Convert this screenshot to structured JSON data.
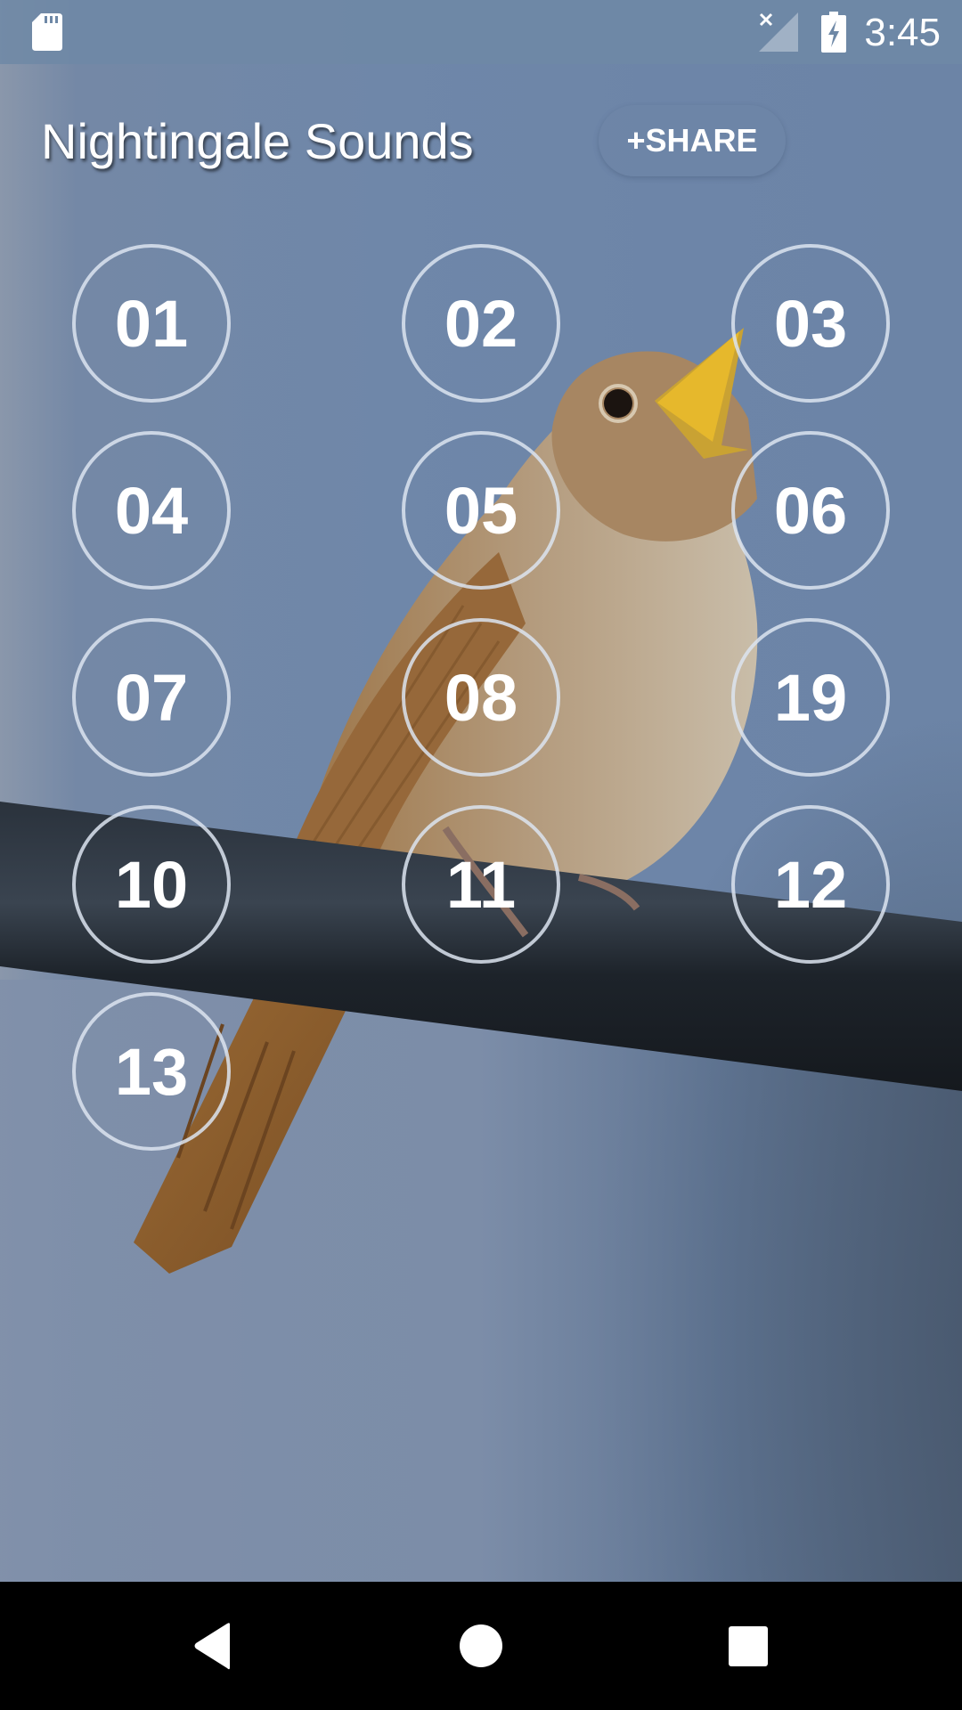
{
  "status_bar": {
    "time": "3:45",
    "icons": [
      "sd-card-icon",
      "no-signal-icon",
      "battery-charging-icon"
    ]
  },
  "header": {
    "title": "Nightingale Sounds",
    "share_label": "+SHARE"
  },
  "sounds": [
    {
      "label": "01"
    },
    {
      "label": "02"
    },
    {
      "label": "03"
    },
    {
      "label": "04"
    },
    {
      "label": "05"
    },
    {
      "label": "06"
    },
    {
      "label": "07"
    },
    {
      "label": "08"
    },
    {
      "label": "19"
    },
    {
      "label": "10"
    },
    {
      "label": "11"
    },
    {
      "label": "12"
    },
    {
      "label": "13"
    }
  ],
  "navigation": {
    "back": "back-icon",
    "home": "home-icon",
    "recents": "recents-icon"
  },
  "colors": {
    "sky": "#6d85a8",
    "status_bar": "#6e88a6",
    "ring": "#dce4f0",
    "nav_bar": "#000000"
  }
}
